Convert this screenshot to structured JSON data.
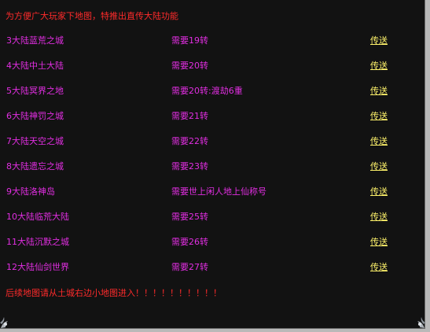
{
  "header": {
    "notice": "为方便广大玩家下地图，特推出直传大陆功能"
  },
  "destinations": [
    {
      "name": "3大陆蓝荒之城",
      "requirement": "需要19转",
      "action": "传送"
    },
    {
      "name": "4大陆中土大陆",
      "requirement": "需要20转",
      "action": "传送"
    },
    {
      "name": "5大陆冥界之地",
      "requirement": "需要20转:渡劫6重",
      "action": "传送"
    },
    {
      "name": "6大陆神罚之城",
      "requirement": "需要21转",
      "action": "传送"
    },
    {
      "name": "7大陆天空之城",
      "requirement": "需要22转",
      "action": "传送"
    },
    {
      "name": "8大陆遗忘之城",
      "requirement": "需要23转",
      "action": "传送"
    },
    {
      "name": "9大陆洛神岛",
      "requirement": "需要世上闲人地上仙称号",
      "action": "传送"
    },
    {
      "name": "10大陆临荒大陆",
      "requirement": "需要25转",
      "action": "传送"
    },
    {
      "name": "11大陆沉默之城",
      "requirement": "需要26转",
      "action": "传送"
    },
    {
      "name": "12大陆仙剑世界",
      "requirement": "需要27转",
      "action": "传送"
    }
  ],
  "footer": {
    "notice": "后续地图请从土城右边小地图进入！！！！！！！！！！"
  },
  "colors": {
    "background": "#121212",
    "notice": "#ff2b2b",
    "destination_text": "#e12ee1",
    "teleport_link": "#fff36b",
    "frame": "#b9b9b9"
  },
  "icons": {
    "bottom_left_corner": "ornament-corner-icon",
    "bottom_right_corner": "ornament-corner-icon"
  }
}
